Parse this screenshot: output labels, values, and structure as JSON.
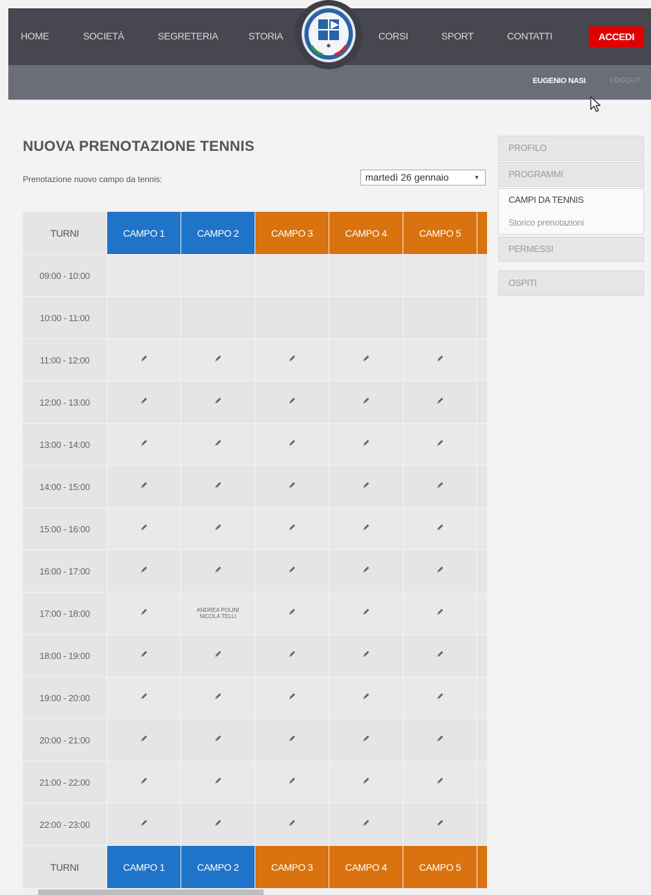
{
  "nav": {
    "left_items": [
      "HOME",
      "SOCIETÀ",
      "SEGRETERIA",
      "STORIA"
    ],
    "right_items": [
      "CORSI",
      "SPORT",
      "CONTATTI"
    ],
    "login_label": "ACCEDI"
  },
  "user": {
    "name": "EUGENIO NASI",
    "separator": ".",
    "logout_label": "LOGOUT"
  },
  "page": {
    "title": "NUOVA PRENOTAZIONE TENNIS",
    "subtitle": "Prenotazione nuovo campo da tennis:",
    "date_select": "martedì 26 gennaio"
  },
  "sidebar": {
    "items": [
      "PROFILO",
      "PROGRAMMI",
      "CAMPI DA TENNIS",
      "PERMESSI",
      "OSPITI"
    ],
    "sub_item": "Storico prenotazioni"
  },
  "table": {
    "turni_label": "TURNI",
    "campi": [
      {
        "label": "CAMPO 1",
        "color": "#1f73c8"
      },
      {
        "label": "CAMPO 2",
        "color": "#1f73c8"
      },
      {
        "label": "CAMPO 3",
        "color": "#d9720f"
      },
      {
        "label": "CAMPO 4",
        "color": "#d9720f"
      },
      {
        "label": "CAMPO 5",
        "color": "#d9720f"
      }
    ],
    "rows": [
      {
        "time": "09:00 - 10:00",
        "slots": [
          "",
          "",
          "",
          "",
          ""
        ]
      },
      {
        "time": "10:00 - 11:00",
        "slots": [
          "",
          "",
          "",
          "",
          ""
        ]
      },
      {
        "time": "11:00 - 12:00",
        "slots": [
          "edit",
          "edit",
          "edit",
          "edit",
          "edit"
        ]
      },
      {
        "time": "12:00 - 13:00",
        "slots": [
          "edit",
          "edit",
          "edit",
          "edit",
          "edit"
        ]
      },
      {
        "time": "13:00 - 14:00",
        "slots": [
          "edit",
          "edit",
          "edit",
          "edit",
          "edit"
        ]
      },
      {
        "time": "14:00 - 15:00",
        "slots": [
          "edit",
          "edit",
          "edit",
          "edit",
          "edit"
        ]
      },
      {
        "time": "15:00 - 16:00",
        "slots": [
          "edit",
          "edit",
          "edit",
          "edit",
          "edit"
        ]
      },
      {
        "time": "16:00 - 17:00",
        "slots": [
          "edit",
          "edit",
          "edit",
          "edit",
          "edit"
        ]
      },
      {
        "time": "17:00 - 18:00",
        "slots": [
          "edit",
          [
            "ANDREA POLINI",
            "NICOLA TELLI"
          ],
          "edit",
          "edit",
          "edit"
        ]
      },
      {
        "time": "18:00 - 19:00",
        "slots": [
          "edit",
          "edit",
          "edit",
          "edit",
          "edit"
        ]
      },
      {
        "time": "19:00 - 20:00",
        "slots": [
          "edit",
          "edit",
          "edit",
          "edit",
          "edit"
        ]
      },
      {
        "time": "20:00 - 21:00",
        "slots": [
          "edit",
          "edit",
          "edit",
          "edit",
          "edit"
        ]
      },
      {
        "time": "21:00 - 22:00",
        "slots": [
          "edit",
          "edit",
          "edit",
          "edit",
          "edit"
        ]
      },
      {
        "time": "22:00 - 23:00",
        "slots": [
          "edit",
          "edit",
          "edit",
          "edit",
          "edit"
        ]
      }
    ],
    "edit_icon": "pencil-icon"
  }
}
